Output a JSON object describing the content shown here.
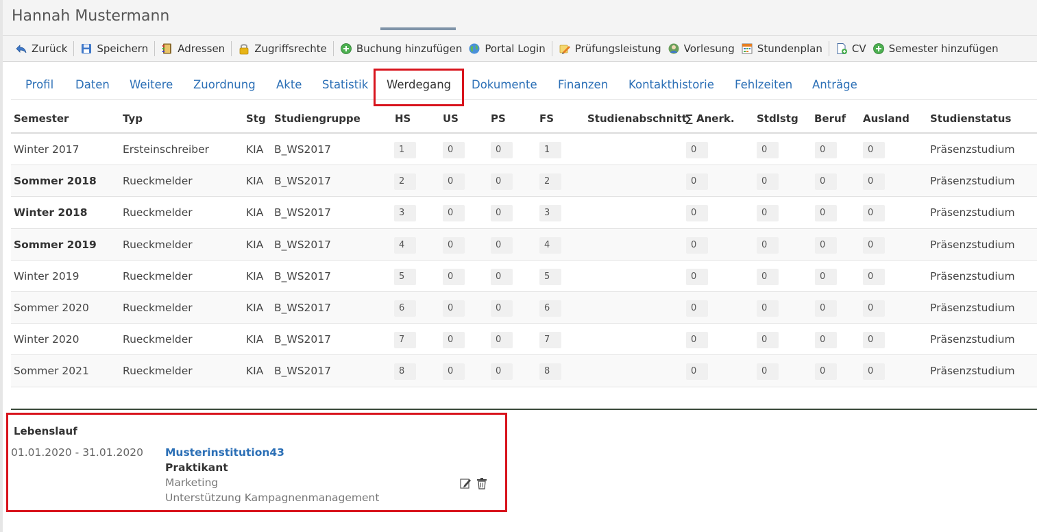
{
  "person": {
    "name": "Hannah Mustermann"
  },
  "toolbar": {
    "items": [
      {
        "label": "Zurück",
        "icon": "back-arrow-icon"
      },
      {
        "label": "Speichern",
        "icon": "floppy-disk-icon"
      },
      {
        "label": "Adressen",
        "icon": "address-book-icon"
      },
      {
        "label": "Zugriffsrechte",
        "icon": "lock-icon"
      },
      {
        "label": "Buchung hinzufügen",
        "icon": "plus-circle-icon"
      },
      {
        "label": "Portal Login",
        "icon": "globe-icon"
      },
      {
        "label": "Prüfungsleistung",
        "icon": "pencil-star-icon"
      },
      {
        "label": "Vorlesung",
        "icon": "lecture-icon"
      },
      {
        "label": "Stundenplan",
        "icon": "calendar-grid-icon"
      },
      {
        "label": "CV",
        "icon": "document-add-icon"
      },
      {
        "label": "Semester hinzufügen",
        "icon": "plus-circle-icon"
      }
    ]
  },
  "tabs": {
    "items": [
      {
        "label": "Profil"
      },
      {
        "label": "Daten"
      },
      {
        "label": "Weitere"
      },
      {
        "label": "Zuordnung"
      },
      {
        "label": "Akte"
      },
      {
        "label": "Statistik"
      },
      {
        "label": "Werdegang",
        "active": true
      },
      {
        "label": "Dokumente"
      },
      {
        "label": "Finanzen"
      },
      {
        "label": "Kontakthistorie"
      },
      {
        "label": "Fehlzeiten"
      },
      {
        "label": "Anträge"
      }
    ]
  },
  "table": {
    "columns": [
      "Semester",
      "Typ",
      "Stg",
      "Studiengruppe",
      "HS",
      "US",
      "PS",
      "FS",
      "Studienabschnitt",
      "∑ Anerk.",
      "Stdlstg",
      "Beruf",
      "Ausland",
      "Studienstatus"
    ],
    "rows": [
      {
        "semester": "Winter 2017",
        "bold": false,
        "typ": "Ersteinschreiber",
        "stg": "KIA",
        "gruppe": "B_WS2017",
        "hs": "1",
        "us": "0",
        "ps": "0",
        "fs": "1",
        "abschnitt": "",
        "anerk": "0",
        "stdlstg": "0",
        "beruf": "0",
        "ausland": "0",
        "status": "Präsenzstudium"
      },
      {
        "semester": "Sommer 2018",
        "bold": true,
        "typ": "Rueckmelder",
        "stg": "KIA",
        "gruppe": "B_WS2017",
        "hs": "2",
        "us": "0",
        "ps": "0",
        "fs": "2",
        "abschnitt": "",
        "anerk": "0",
        "stdlstg": "0",
        "beruf": "0",
        "ausland": "0",
        "status": "Präsenzstudium"
      },
      {
        "semester": "Winter 2018",
        "bold": true,
        "typ": "Rueckmelder",
        "stg": "KIA",
        "gruppe": "B_WS2017",
        "hs": "3",
        "us": "0",
        "ps": "0",
        "fs": "3",
        "abschnitt": "",
        "anerk": "0",
        "stdlstg": "0",
        "beruf": "0",
        "ausland": "0",
        "status": "Präsenzstudium"
      },
      {
        "semester": "Sommer 2019",
        "bold": true,
        "typ": "Rueckmelder",
        "stg": "KIA",
        "gruppe": "B_WS2017",
        "hs": "4",
        "us": "0",
        "ps": "0",
        "fs": "4",
        "abschnitt": "",
        "anerk": "0",
        "stdlstg": "0",
        "beruf": "0",
        "ausland": "0",
        "status": "Präsenzstudium"
      },
      {
        "semester": "Winter 2019",
        "bold": false,
        "typ": "Rueckmelder",
        "stg": "KIA",
        "gruppe": "B_WS2017",
        "hs": "5",
        "us": "0",
        "ps": "0",
        "fs": "5",
        "abschnitt": "",
        "anerk": "0",
        "stdlstg": "0",
        "beruf": "0",
        "ausland": "0",
        "status": "Präsenzstudium"
      },
      {
        "semester": "Sommer 2020",
        "bold": false,
        "typ": "Rueckmelder",
        "stg": "KIA",
        "gruppe": "B_WS2017",
        "hs": "6",
        "us": "0",
        "ps": "0",
        "fs": "6",
        "abschnitt": "",
        "anerk": "0",
        "stdlstg": "0",
        "beruf": "0",
        "ausland": "0",
        "status": "Präsenzstudium"
      },
      {
        "semester": "Winter 2020",
        "bold": false,
        "typ": "Rueckmelder",
        "stg": "KIA",
        "gruppe": "B_WS2017",
        "hs": "7",
        "us": "0",
        "ps": "0",
        "fs": "7",
        "abschnitt": "",
        "anerk": "0",
        "stdlstg": "0",
        "beruf": "0",
        "ausland": "0",
        "status": "Präsenzstudium"
      },
      {
        "semester": "Sommer 2021",
        "bold": false,
        "typ": "Rueckmelder",
        "stg": "KIA",
        "gruppe": "B_WS2017",
        "hs": "8",
        "us": "0",
        "ps": "0",
        "fs": "8",
        "abschnitt": "",
        "anerk": "0",
        "stdlstg": "0",
        "beruf": "0",
        "ausland": "0",
        "status": "Präsenzstudium"
      }
    ]
  },
  "cv": {
    "title": "Lebenslauf",
    "entries": [
      {
        "dates": "01.01.2020 - 31.01.2020",
        "institution": "Musterinstitution43",
        "position": "Praktikant",
        "area": "Marketing",
        "description": "Unterstützung Kampagnenmanagement",
        "actions": [
          {
            "icon": "edit-icon"
          },
          {
            "icon": "trash-icon"
          }
        ]
      }
    ]
  },
  "colors": {
    "link": "#2b6fb6",
    "highlight": "#d8141d",
    "tab_underline": "#7f93a8"
  }
}
